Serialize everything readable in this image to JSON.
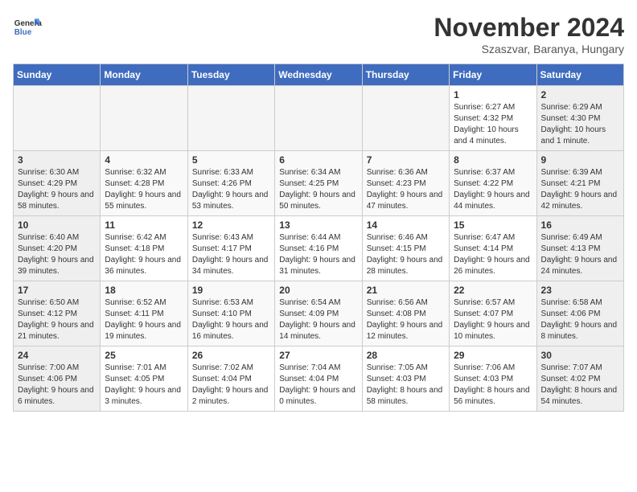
{
  "header": {
    "logo_general": "General",
    "logo_blue": "Blue",
    "month_year": "November 2024",
    "location": "Szaszvar, Baranya, Hungary"
  },
  "days_of_week": [
    "Sunday",
    "Monday",
    "Tuesday",
    "Wednesday",
    "Thursday",
    "Friday",
    "Saturday"
  ],
  "weeks": [
    [
      {
        "day": "",
        "info": ""
      },
      {
        "day": "",
        "info": ""
      },
      {
        "day": "",
        "info": ""
      },
      {
        "day": "",
        "info": ""
      },
      {
        "day": "",
        "info": ""
      },
      {
        "day": "1",
        "info": "Sunrise: 6:27 AM\nSunset: 4:32 PM\nDaylight: 10 hours and 4 minutes."
      },
      {
        "day": "2",
        "info": "Sunrise: 6:29 AM\nSunset: 4:30 PM\nDaylight: 10 hours and 1 minute."
      }
    ],
    [
      {
        "day": "3",
        "info": "Sunrise: 6:30 AM\nSunset: 4:29 PM\nDaylight: 9 hours and 58 minutes."
      },
      {
        "day": "4",
        "info": "Sunrise: 6:32 AM\nSunset: 4:28 PM\nDaylight: 9 hours and 55 minutes."
      },
      {
        "day": "5",
        "info": "Sunrise: 6:33 AM\nSunset: 4:26 PM\nDaylight: 9 hours and 53 minutes."
      },
      {
        "day": "6",
        "info": "Sunrise: 6:34 AM\nSunset: 4:25 PM\nDaylight: 9 hours and 50 minutes."
      },
      {
        "day": "7",
        "info": "Sunrise: 6:36 AM\nSunset: 4:23 PM\nDaylight: 9 hours and 47 minutes."
      },
      {
        "day": "8",
        "info": "Sunrise: 6:37 AM\nSunset: 4:22 PM\nDaylight: 9 hours and 44 minutes."
      },
      {
        "day": "9",
        "info": "Sunrise: 6:39 AM\nSunset: 4:21 PM\nDaylight: 9 hours and 42 minutes."
      }
    ],
    [
      {
        "day": "10",
        "info": "Sunrise: 6:40 AM\nSunset: 4:20 PM\nDaylight: 9 hours and 39 minutes."
      },
      {
        "day": "11",
        "info": "Sunrise: 6:42 AM\nSunset: 4:18 PM\nDaylight: 9 hours and 36 minutes."
      },
      {
        "day": "12",
        "info": "Sunrise: 6:43 AM\nSunset: 4:17 PM\nDaylight: 9 hours and 34 minutes."
      },
      {
        "day": "13",
        "info": "Sunrise: 6:44 AM\nSunset: 4:16 PM\nDaylight: 9 hours and 31 minutes."
      },
      {
        "day": "14",
        "info": "Sunrise: 6:46 AM\nSunset: 4:15 PM\nDaylight: 9 hours and 28 minutes."
      },
      {
        "day": "15",
        "info": "Sunrise: 6:47 AM\nSunset: 4:14 PM\nDaylight: 9 hours and 26 minutes."
      },
      {
        "day": "16",
        "info": "Sunrise: 6:49 AM\nSunset: 4:13 PM\nDaylight: 9 hours and 24 minutes."
      }
    ],
    [
      {
        "day": "17",
        "info": "Sunrise: 6:50 AM\nSunset: 4:12 PM\nDaylight: 9 hours and 21 minutes."
      },
      {
        "day": "18",
        "info": "Sunrise: 6:52 AM\nSunset: 4:11 PM\nDaylight: 9 hours and 19 minutes."
      },
      {
        "day": "19",
        "info": "Sunrise: 6:53 AM\nSunset: 4:10 PM\nDaylight: 9 hours and 16 minutes."
      },
      {
        "day": "20",
        "info": "Sunrise: 6:54 AM\nSunset: 4:09 PM\nDaylight: 9 hours and 14 minutes."
      },
      {
        "day": "21",
        "info": "Sunrise: 6:56 AM\nSunset: 4:08 PM\nDaylight: 9 hours and 12 minutes."
      },
      {
        "day": "22",
        "info": "Sunrise: 6:57 AM\nSunset: 4:07 PM\nDaylight: 9 hours and 10 minutes."
      },
      {
        "day": "23",
        "info": "Sunrise: 6:58 AM\nSunset: 4:06 PM\nDaylight: 9 hours and 8 minutes."
      }
    ],
    [
      {
        "day": "24",
        "info": "Sunrise: 7:00 AM\nSunset: 4:06 PM\nDaylight: 9 hours and 6 minutes."
      },
      {
        "day": "25",
        "info": "Sunrise: 7:01 AM\nSunset: 4:05 PM\nDaylight: 9 hours and 3 minutes."
      },
      {
        "day": "26",
        "info": "Sunrise: 7:02 AM\nSunset: 4:04 PM\nDaylight: 9 hours and 2 minutes."
      },
      {
        "day": "27",
        "info": "Sunrise: 7:04 AM\nSunset: 4:04 PM\nDaylight: 9 hours and 0 minutes."
      },
      {
        "day": "28",
        "info": "Sunrise: 7:05 AM\nSunset: 4:03 PM\nDaylight: 8 hours and 58 minutes."
      },
      {
        "day": "29",
        "info": "Sunrise: 7:06 AM\nSunset: 4:03 PM\nDaylight: 8 hours and 56 minutes."
      },
      {
        "day": "30",
        "info": "Sunrise: 7:07 AM\nSunset: 4:02 PM\nDaylight: 8 hours and 54 minutes."
      }
    ]
  ]
}
